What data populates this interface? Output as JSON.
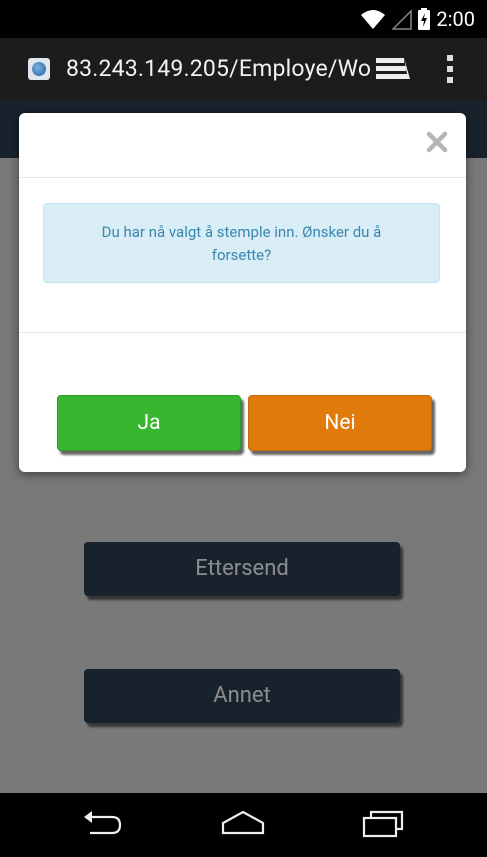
{
  "status_bar": {
    "time": "2:00",
    "icons": [
      "wifi-icon",
      "signal-icon",
      "battery-icon"
    ]
  },
  "browser": {
    "url": "83.243.149.205/Employe/Wo",
    "icons": [
      "site-favicon-icon",
      "tabs-icon",
      "overflow-menu-icon"
    ]
  },
  "page": {
    "buttons": [
      {
        "label": "Ettersend"
      },
      {
        "label": "Annet"
      }
    ]
  },
  "modal": {
    "close_icon": "close-x-icon",
    "message": "Du har nå valgt å stemple inn. Ønsker du å forsette?",
    "yes_label": "Ja",
    "no_label": "Nei"
  },
  "colors": {
    "header": "#2c3e50",
    "yes_button": "#39b62f",
    "no_button": "#e07a0b",
    "alert_bg": "#d9edf7",
    "alert_text": "#3a87ad"
  },
  "nav_bar": {
    "icons": [
      "back-icon",
      "home-icon",
      "recent-apps-icon"
    ]
  }
}
